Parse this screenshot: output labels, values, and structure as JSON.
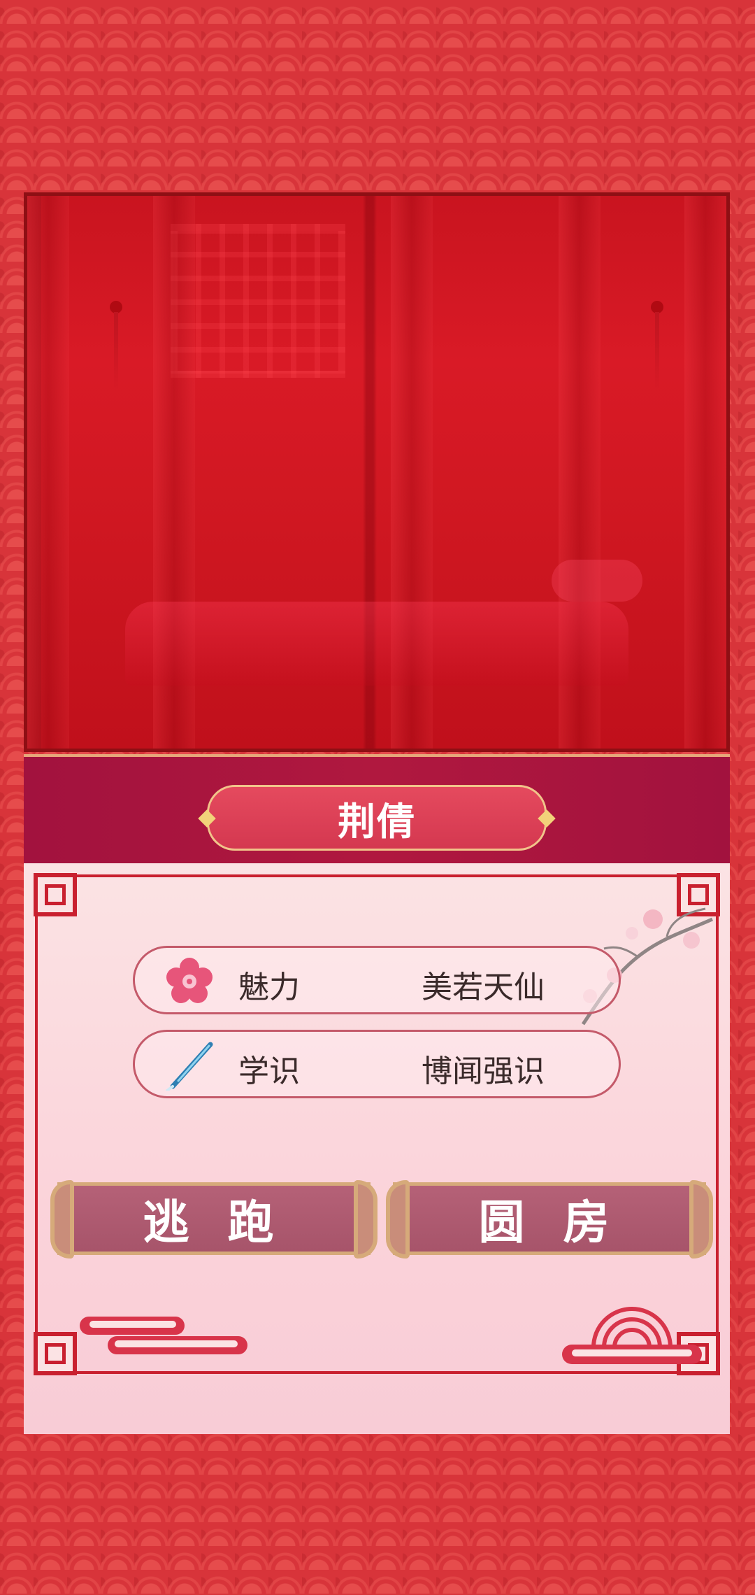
{
  "character": {
    "name": "荆倩"
  },
  "stats": [
    {
      "icon": "plum-blossom-icon",
      "label": "魅力",
      "value": "美若天仙"
    },
    {
      "icon": "brush-pen-icon",
      "label": "学识",
      "value": "博闻强识"
    }
  ],
  "choices": {
    "escape_label": "逃 跑",
    "consummate_label": "圆 房"
  },
  "colors": {
    "background": "#d8343a",
    "name_bar": "#a2123e",
    "panel": "#fbe3e4",
    "frame_red": "#c9202f",
    "button": "#b56177",
    "gold_trim": "#d6aa7a"
  }
}
